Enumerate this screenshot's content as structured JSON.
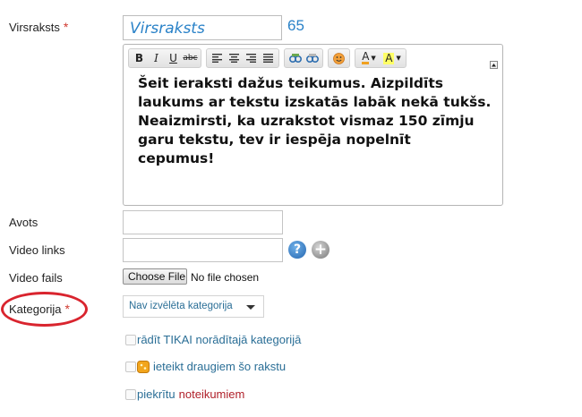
{
  "form": {
    "title_label": "Virsraksts",
    "required_mark": "*",
    "title_value": "Virsraksts",
    "title_char_count": "65",
    "source_label": "Avots",
    "source_value": "",
    "video_link_label": "Video links",
    "video_link_value": "",
    "video_file_label": "Video fails",
    "choose_file_label": "Choose File",
    "no_file_text": "No file chosen",
    "category_label": "Kategorija",
    "category_selected": "Nav izvēlēta kategorija",
    "help_symbol": "?",
    "add_symbol": "+",
    "options": {
      "only_category": "rādīt TIKAI norādītajā kategorijā",
      "recommend": "ieteikt draugiem šo rakstu",
      "agree_prefix": "piekrītu",
      "agree_link": "noteikumiem"
    }
  },
  "editor": {
    "toolbar": {
      "bold": "B",
      "italic": "I",
      "underline": "U",
      "strike": "abc",
      "font_color": "A",
      "highlight": "A"
    },
    "content": "Šeit ieraksti dažus teikumus. Aizpildīts laukums ar tekstu izskatās labāk nekā tukšs. Neaizmirsti, ka uzrakstot vismaz 150 zīmju garu tekstu, tev ir iespēja nopelnīt cepumus!"
  },
  "colors": {
    "accent_blue": "#2a82c8",
    "required_red": "#d0392f",
    "annotation_red": "#d9242e",
    "highlight_yellow": "#ffff66"
  }
}
